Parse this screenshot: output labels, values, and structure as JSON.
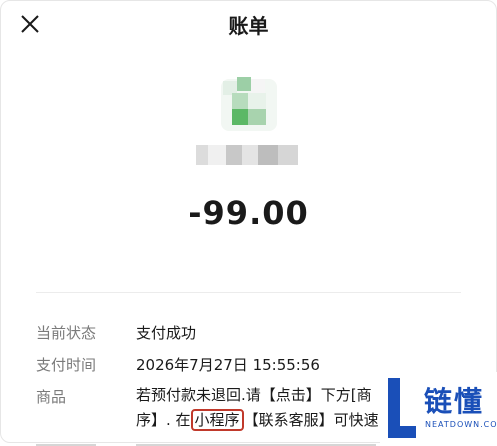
{
  "header": {
    "title": "账单",
    "close_icon": "close-icon"
  },
  "merchant": {
    "logo_icon": "merchant-logo-icon"
  },
  "amount": "-99.00",
  "details": {
    "status_label": "当前状态",
    "status_value": "支付成功",
    "time_label": "支付时间",
    "time_value": "2026年7月27日 15:55:56",
    "product_label": "商品",
    "product_part1": "若预付款未退回.请【点击】下方[商",
    "product_part2": "序】. 在",
    "product_highlight": "小程序",
    "product_part3": "【联系客服】可快速"
  },
  "watermark": {
    "name_cn": "链懂",
    "name_en": "NEATDOWN.COM"
  },
  "colors": {
    "highlight_border": "#c0392b",
    "watermark_blue": "#1a4fb8",
    "logo_green": "#4caf50"
  }
}
